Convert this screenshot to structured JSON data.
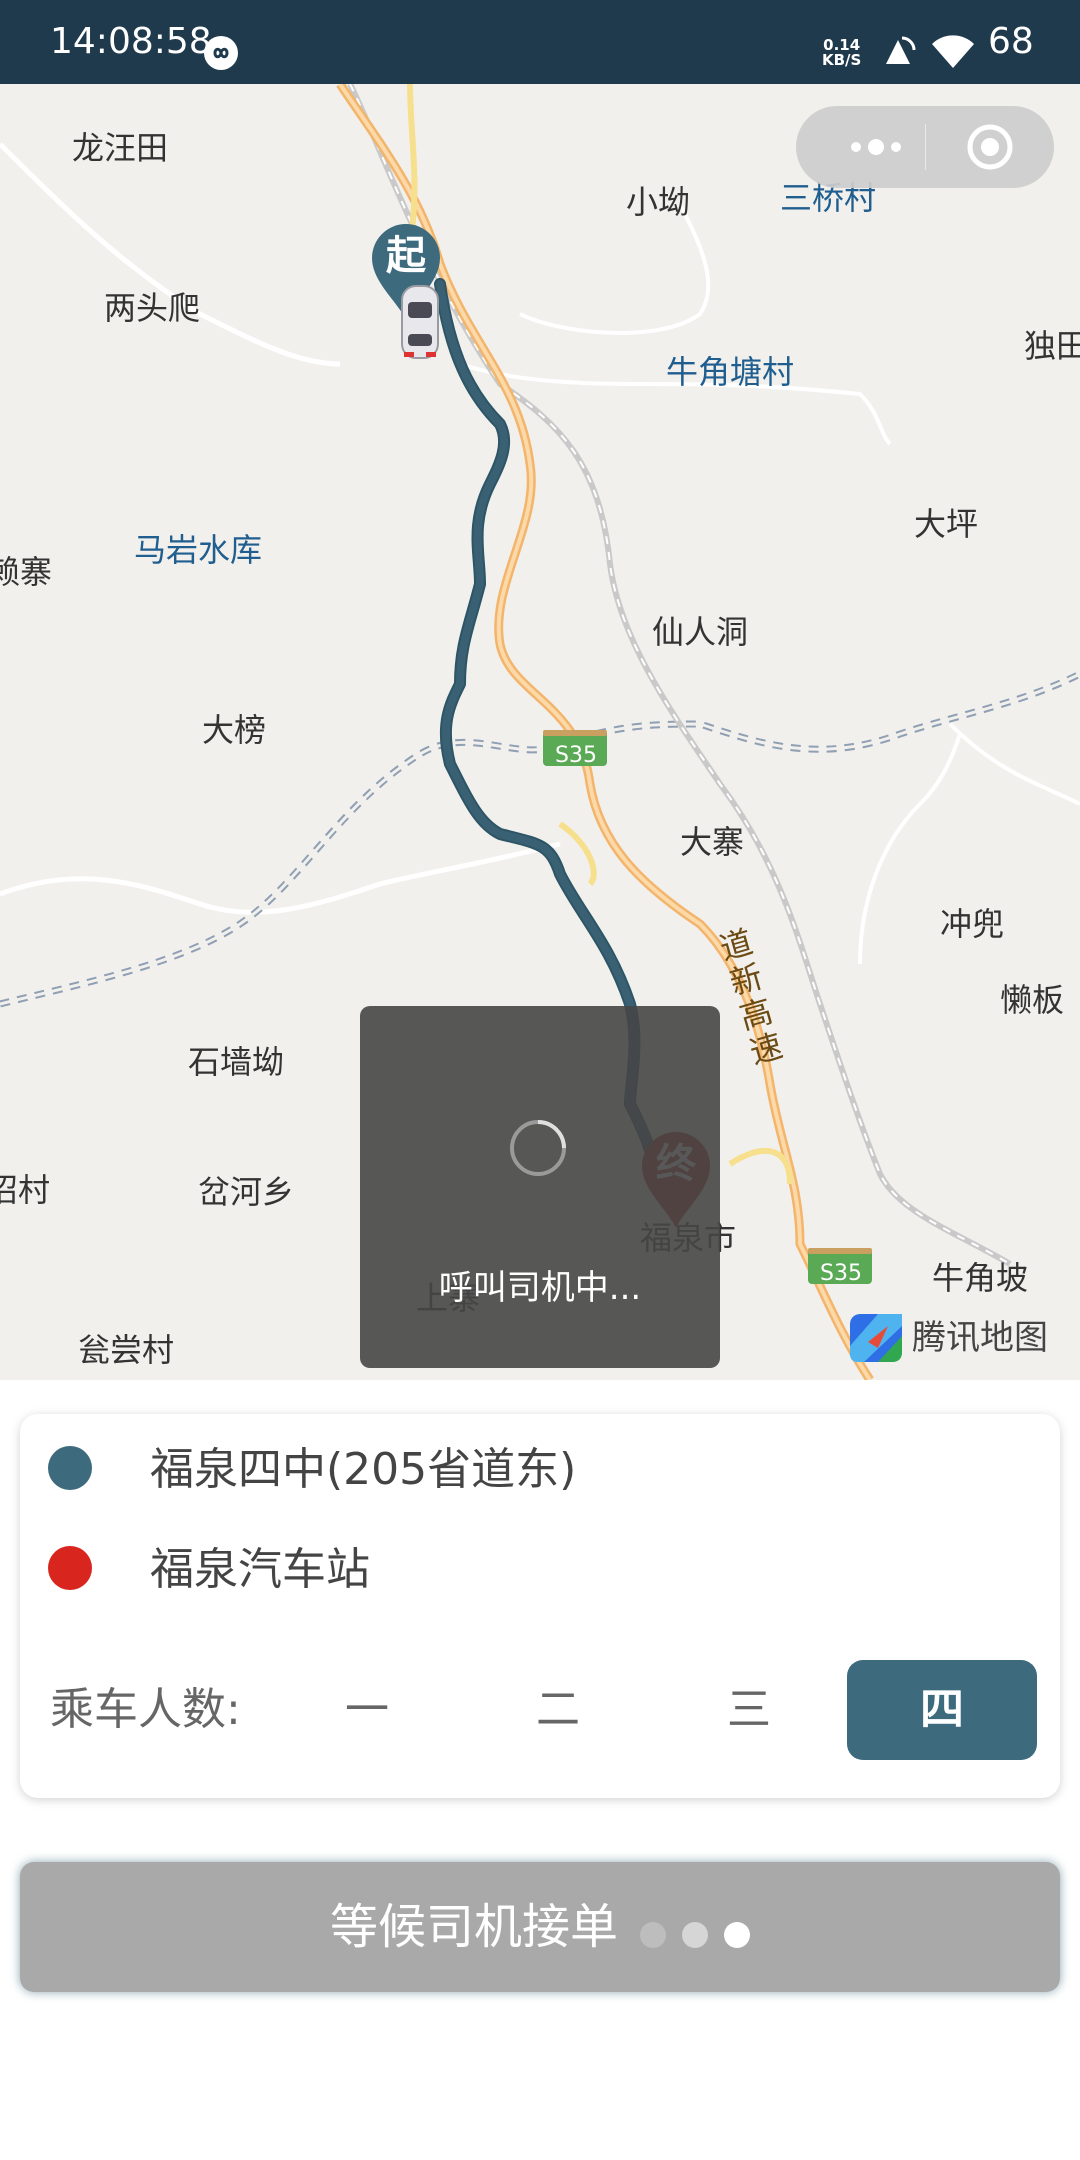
{
  "status_bar": {
    "time": "14:08:58",
    "loop_icon": "infinity-loop-icon",
    "net_speed_value": "0.14",
    "net_speed_unit": "KB/S",
    "vibrate_icon": "vibrate-icon",
    "wifi_icon": "wifi-icon",
    "battery": "68"
  },
  "map": {
    "places": [
      "龙汪田",
      "小坳",
      "三桥村",
      "两头爬",
      "牛角塘村",
      "独田",
      "大坪",
      "马岩水库",
      "赖寨",
      "仙人洞",
      "大榜",
      "大寨",
      "冲兜",
      "懒板",
      "石墙坳",
      "沼村",
      "岔河乡",
      "福泉市",
      "牛角坡",
      "上寨",
      "瓮尝村"
    ],
    "road_labels": [
      "S35",
      "S35",
      "道新高速"
    ],
    "start_marker": "起",
    "end_marker": "终",
    "logo_text": "腾讯地图",
    "route_color": "#3a6173",
    "capsule": {
      "more_icon": "more-dots-icon",
      "close_icon": "target-circle-icon"
    }
  },
  "toast": {
    "text": "呼叫司机中..."
  },
  "trip": {
    "origin": "福泉四中(205省道东)",
    "destination": "福泉汽车站",
    "origin_color": "#3d6a7d",
    "destination_color": "#d8261e",
    "passenger_label": "乘车人数:",
    "passenger_options": [
      "一",
      "二",
      "三",
      "四"
    ],
    "selected_passengers": "四"
  },
  "wait_button": {
    "label": "等候司机接单"
  }
}
